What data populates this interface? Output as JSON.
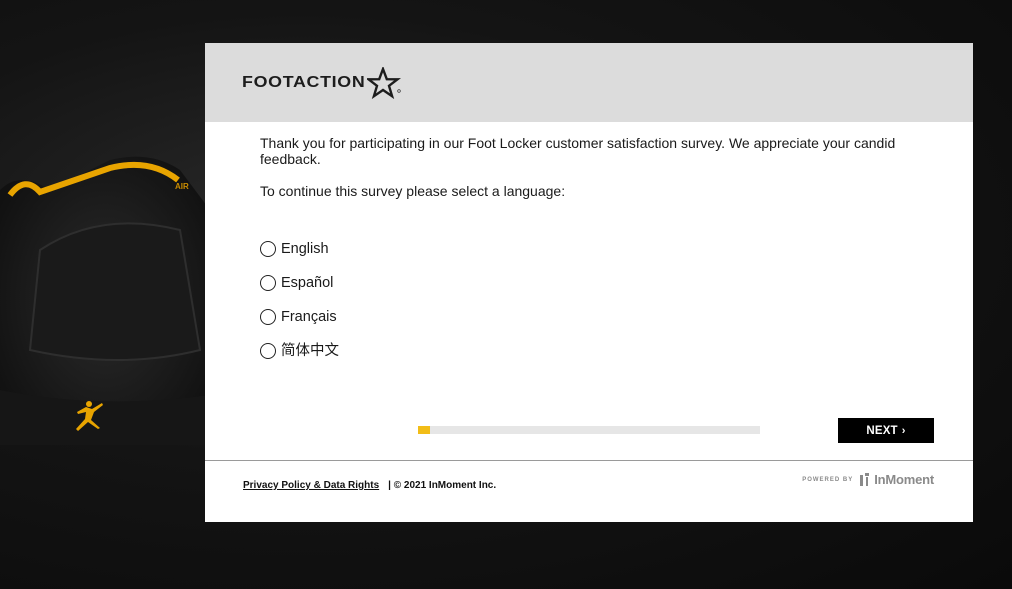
{
  "brand": {
    "logo_text": "FOOTACTION",
    "logo_icon": "star-icon"
  },
  "survey": {
    "intro": "Thank you for participating in our Foot Locker customer satisfaction survey. We appreciate your candid feedback.",
    "language_prompt": "To continue this survey please select a language:",
    "languages": [
      "English",
      "Español",
      "Français",
      "简体中文"
    ],
    "progress_fraction": 0.035,
    "next_label": "NEXT",
    "next_icon": "chevron-right-icon"
  },
  "footer": {
    "privacy_link": "Privacy Policy & Data Rights",
    "copyright": "| © 2021 InMoment Inc.",
    "powered_by": "POWERED BY",
    "provider": "InMoment"
  },
  "colors": {
    "accent": "#f2bd17",
    "header_bg": "#dcdcdc",
    "button_bg": "#000000"
  }
}
